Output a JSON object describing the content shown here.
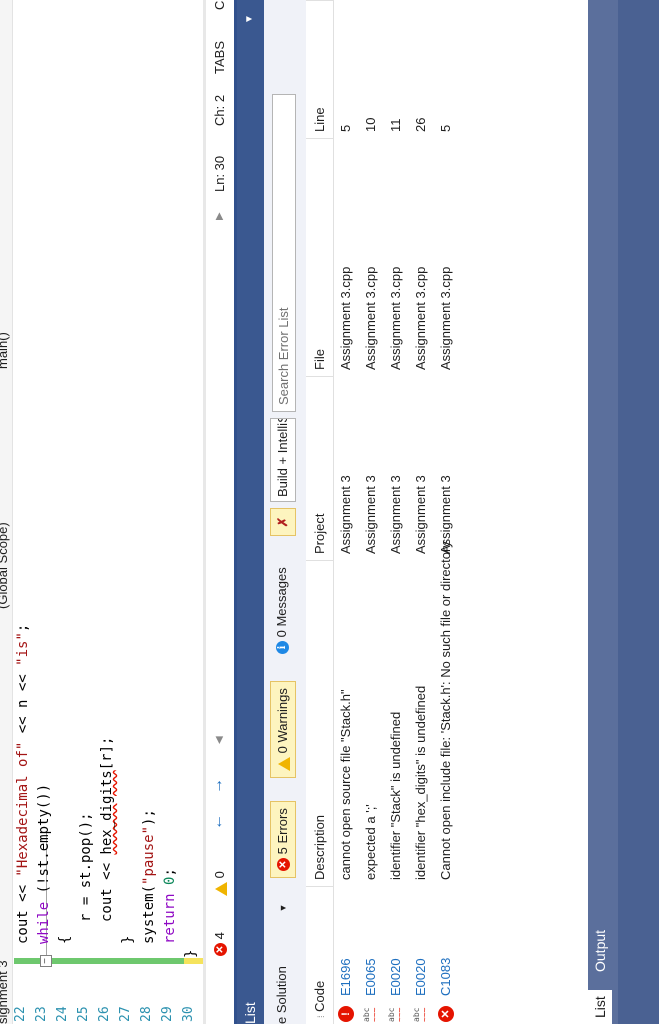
{
  "nav": {
    "project": "signment 3",
    "scope": "(Global Scope)",
    "member": "main()"
  },
  "editor": {
    "line_numbers": [
      "22",
      "23",
      "24",
      "25",
      "26",
      "27",
      "28",
      "29",
      "30"
    ]
  },
  "code": {
    "l22_a": "cout << ",
    "l22_b": "\"Hexadecimal of\"",
    "l22_c": " << n << ",
    "l22_d": "\"is\"",
    "l22_e": ";",
    "l23_a": "while",
    "l23_b": " (!st.empty())",
    "l24": "{",
    "l25": "r = st.pop();",
    "l26_a": "cout << ",
    "l26_b": "hex_digits",
    "l26_c": "[r];",
    "l27": "}",
    "l28_a": "system(",
    "l28_b": "\"pause\"",
    "l28_c": ");",
    "l29_a": "return",
    "l29_b": " ",
    "l29_c": "0",
    "l29_d": ";",
    "l30": "}"
  },
  "status": {
    "errors": "4",
    "warnings": "0",
    "ln": "Ln: 30",
    "ch": "Ch: 2",
    "tabs": "TABS",
    "extra": "C"
  },
  "panel": {
    "title": "List"
  },
  "toolbar": {
    "scope": "e Solution",
    "errors_btn": "5 Errors",
    "warnings_btn": "0 Warnings",
    "messages_btn": "0 Messages",
    "source": "Build + IntelliSense",
    "search_placeholder": "Search Error List"
  },
  "table": {
    "headers": {
      "code": "Code",
      "description": "Description",
      "project": "Project",
      "file": "File",
      "line": "Line"
    },
    "rows": [
      {
        "code": "E1696",
        "description": "cannot open source file \"Stack.h\"",
        "project": "Assignment 3",
        "file": "Assignment 3.cpp",
        "line": "5"
      },
      {
        "code": "E0065",
        "description": "expected a ';'",
        "project": "Assignment 3",
        "file": "Assignment 3.cpp",
        "line": "10"
      },
      {
        "code": "E0020",
        "description": "identifier \"Stack\" is undefined",
        "project": "Assignment 3",
        "file": "Assignment 3.cpp",
        "line": "11"
      },
      {
        "code": "E0020",
        "description": "identifier \"hex_digits\" is undefined",
        "project": "Assignment 3",
        "file": "Assignment 3.cpp",
        "line": "26"
      },
      {
        "code": "C1083",
        "description": "Cannot open include file: 'Stack.h': No such file or directory",
        "project": "Assignment 3",
        "file": "Assignment 3.cpp",
        "line": "5"
      }
    ]
  },
  "bottom_tabs": {
    "list": "List",
    "output": "Output"
  },
  "colors": {
    "panel_header": "#3a5890",
    "error": "#e51400",
    "warning": "#f0b400",
    "info": "#1e88e5"
  }
}
